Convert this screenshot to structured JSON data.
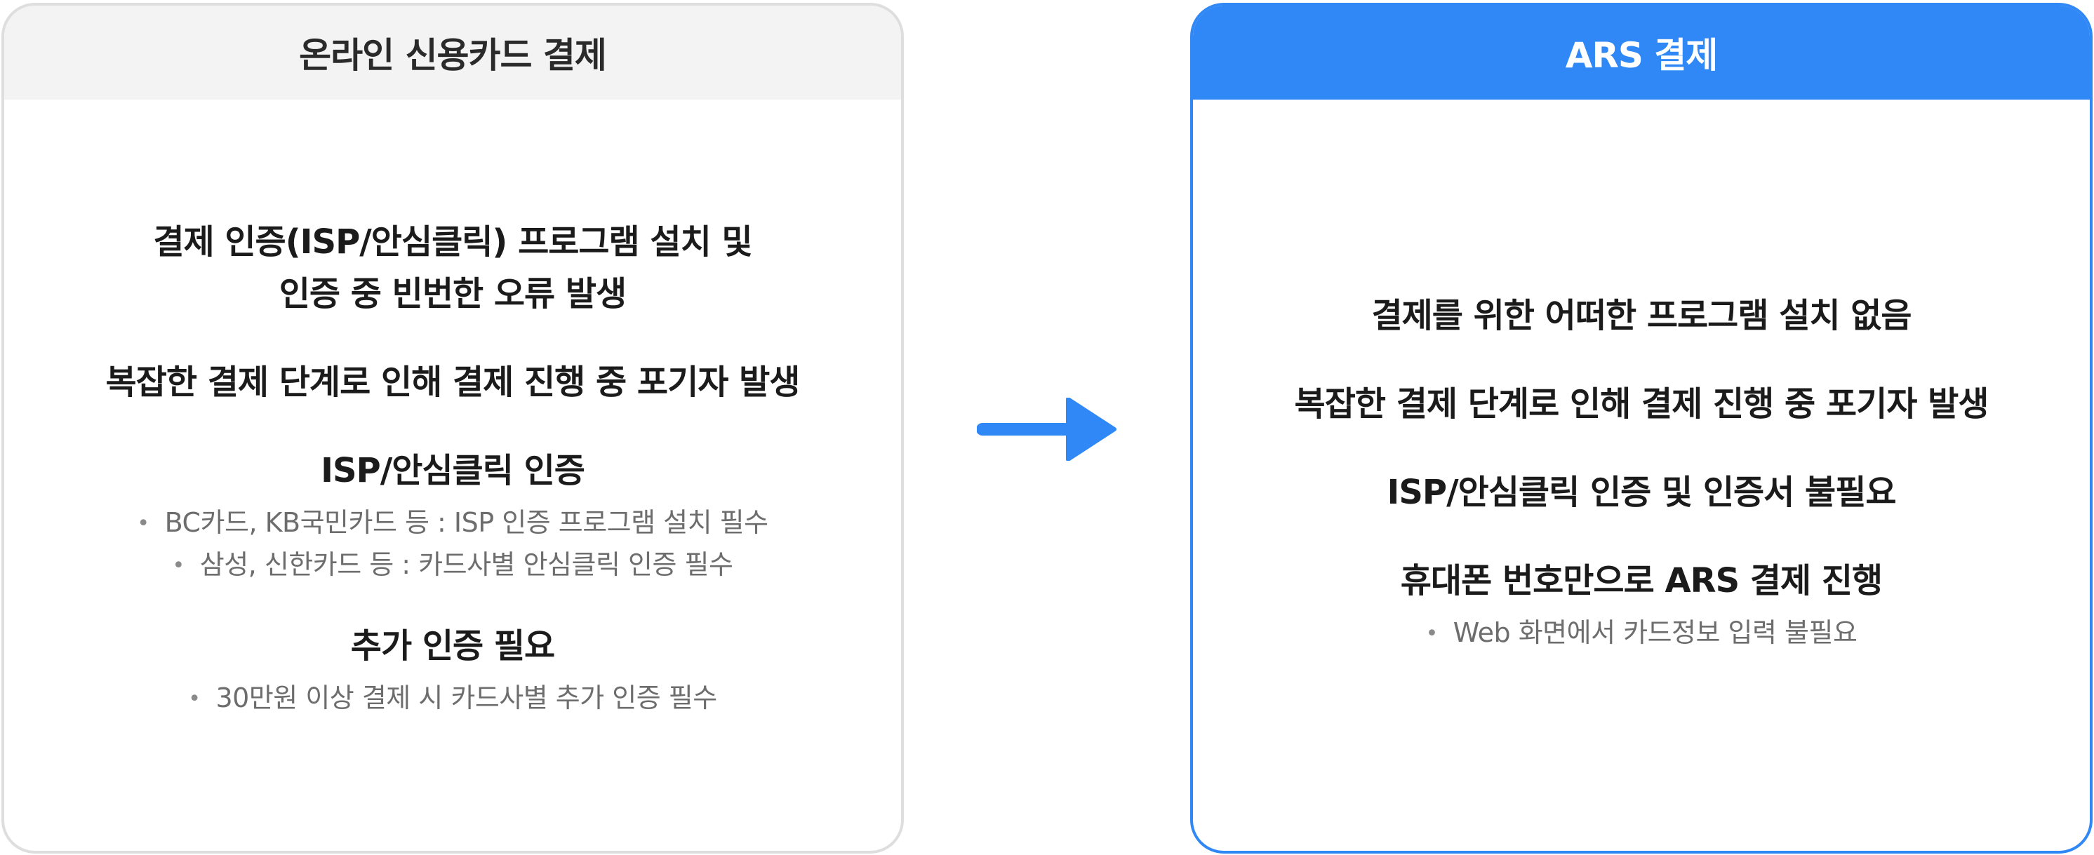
{
  "left_card": {
    "title": "온라인 신용카드 결제",
    "sections": [
      {
        "lines": [
          "결제 인증(ISP/안심클릭) 프로그램 설치 및",
          "인증 중 빈번한 오류 발생"
        ],
        "bullets": []
      },
      {
        "lines": [
          "복잡한 결제 단계로 인해 결제 진행 중 포기자 발생"
        ],
        "bullets": []
      },
      {
        "lines": [
          "ISP/안심클릭 인증"
        ],
        "bullets": [
          "BC카드, KB국민카드 등 : ISP 인증 프로그램 설치 필수",
          "삼성, 신한카드 등 : 카드사별 안심클릭 인증 필수"
        ]
      },
      {
        "lines": [
          "추가 인증 필요"
        ],
        "bullets": [
          "30만원 이상 결제 시 카드사별 추가 인증 필수"
        ]
      }
    ]
  },
  "right_card": {
    "title": "ARS 결제",
    "sections": [
      {
        "lines": [
          "결제를 위한 어떠한 프로그램 설치 없음"
        ],
        "bullets": []
      },
      {
        "lines": [
          "복잡한 결제 단계로 인해 결제 진행 중 포기자 발생"
        ],
        "bullets": []
      },
      {
        "lines": [
          "ISP/안심클릭 인증 및 인증서 불필요"
        ],
        "bullets": []
      },
      {
        "lines": [
          "휴대폰 번호만으로 ARS 결제 진행"
        ],
        "bullets": [
          "Web 화면에서 카드정보 입력 불필요"
        ]
      }
    ]
  },
  "colors": {
    "accent": "#2f88f5",
    "left_border": "#dedede",
    "left_header_bg": "#f3f3f3"
  },
  "icons": {
    "connector": "arrow-right-icon",
    "bullet": "bullet-dot-icon"
  }
}
